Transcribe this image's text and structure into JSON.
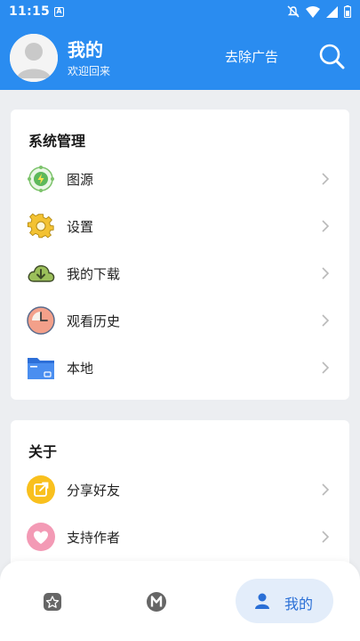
{
  "status_bar": {
    "time": "11:15",
    "notification_badge": "A"
  },
  "header": {
    "title": "我的",
    "subtitle": "欢迎回来",
    "remove_ads": "去除广告",
    "background": "#2a8cf0"
  },
  "system_section": {
    "title": "系统管理",
    "items": [
      {
        "label": "图源",
        "icon": "source-icon"
      },
      {
        "label": "设置",
        "icon": "gear-icon"
      },
      {
        "label": "我的下载",
        "icon": "cloud-download-icon"
      },
      {
        "label": "观看历史",
        "icon": "clock-icon"
      },
      {
        "label": "本地",
        "icon": "folder-icon"
      }
    ]
  },
  "about_section": {
    "title": "关于",
    "items": [
      {
        "label": "分享好友",
        "icon": "share-icon"
      },
      {
        "label": "支持作者",
        "icon": "heart-icon"
      }
    ]
  },
  "bottom_nav": {
    "items": [
      {
        "icon": "star-box-icon"
      },
      {
        "icon": "m-circle-icon"
      },
      {
        "label": "我的",
        "icon": "person-icon",
        "active": true
      }
    ]
  }
}
